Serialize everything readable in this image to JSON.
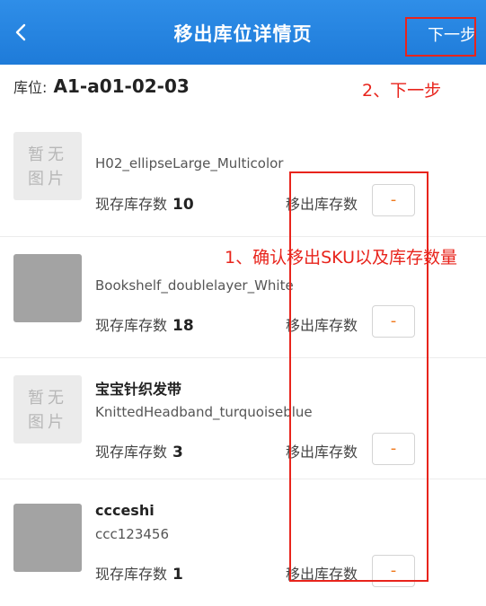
{
  "header": {
    "title": "移出库位详情页",
    "next_label": "下一步",
    "bg_color": "#2286e2"
  },
  "location": {
    "label": "库位:",
    "value": "A1-a01-02-03"
  },
  "placeholder_text": [
    "暂无",
    "图片"
  ],
  "items": [
    {
      "thumb": "placeholder",
      "name": "",
      "sku": "H02_ellipseLarge_Multicolor",
      "stock_label": "现存库存数",
      "stock_qty": "10",
      "move_label": "移出库存数",
      "move_qty": "-"
    },
    {
      "thumb": "gray",
      "name": "",
      "sku": "Bookshelf_doublelayer_White",
      "stock_label": "现存库存数",
      "stock_qty": "18",
      "move_label": "移出库存数",
      "move_qty": "-"
    },
    {
      "thumb": "placeholder",
      "name": "宝宝针织发带",
      "sku": "KnittedHeadband_turquoiseblue",
      "stock_label": "现存库存数",
      "stock_qty": "3",
      "move_label": "移出库存数",
      "move_qty": "-"
    },
    {
      "thumb": "gray",
      "name": "ccceshi",
      "sku": "ccc123456",
      "stock_label": "现存库存数",
      "stock_qty": "1",
      "move_label": "移出库存数",
      "move_qty": "-"
    }
  ],
  "annotations": {
    "step1": "1、确认移出SKU以及库存数量",
    "step2": "2、下一步",
    "color": "#e8241c"
  }
}
